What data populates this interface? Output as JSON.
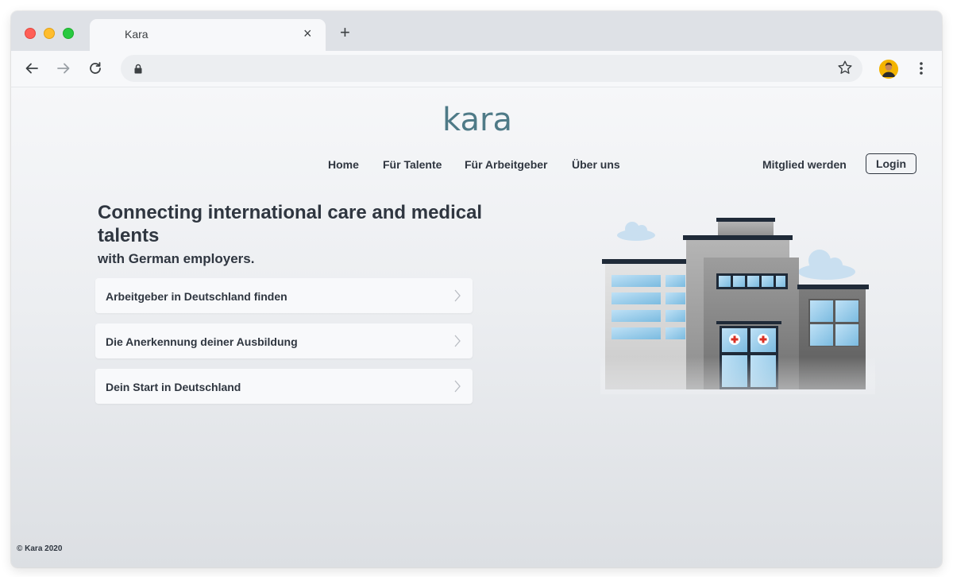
{
  "browser": {
    "tab_title": "Kara",
    "tab_close": "×",
    "new_tab": "+"
  },
  "site": {
    "logo_text": "kara",
    "nav": {
      "home": "Home",
      "talents": "Für Talente",
      "employers": "Für Arbeitgeber",
      "about": "Über uns",
      "join": "Mitglied werden",
      "login": "Login"
    },
    "hero": {
      "headline": "Connecting international care and medical talents",
      "subheadline": "with German employers."
    },
    "cards": [
      {
        "label": "Arbeitgeber in Deutschland finden"
      },
      {
        "label": "Die Anerkennung deiner Ausbildung"
      },
      {
        "label": "Dein Start in Deutschland"
      }
    ],
    "footer": "© Kara 2020"
  },
  "icons": [
    "back-arrow-icon",
    "forward-arrow-icon",
    "reload-icon",
    "lock-icon",
    "star-icon",
    "avatar",
    "kebab-menu-icon",
    "chevron-right-icon",
    "hospital-illustration"
  ],
  "colors": {
    "brand": "#4e7a87",
    "text": "#2f3640",
    "tabbar": "#dee1e6",
    "toolbar": "#f7f8fa"
  }
}
